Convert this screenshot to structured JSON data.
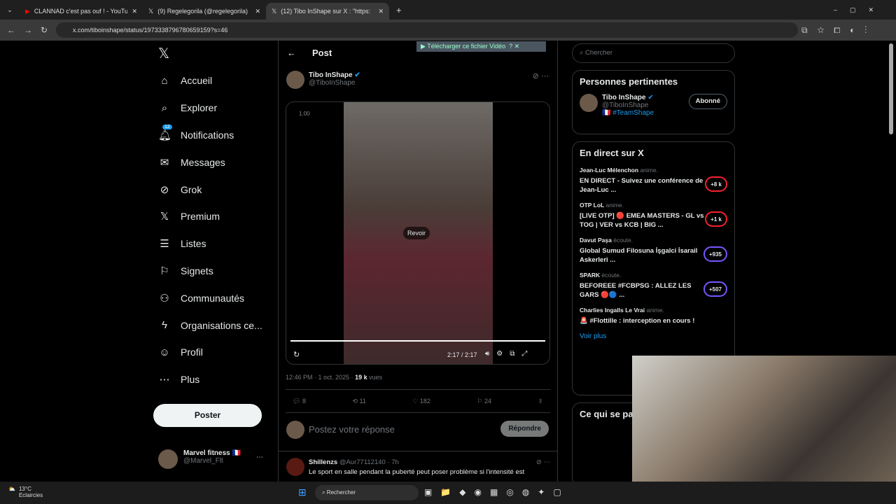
{
  "browser": {
    "tabs": [
      {
        "title": "CLANNAD c'est pas ouf ! - YouTube"
      },
      {
        "title": "(9) Regelegorila (@regelegorila)"
      },
      {
        "title": "(12) Tibo InShape sur X : \"https:"
      }
    ],
    "url": "x.com/tiboinshape/status/1973338796780659159?s=46"
  },
  "sidebar": {
    "items": [
      {
        "label": "Accueil",
        "icon": "⌂"
      },
      {
        "label": "Explorer",
        "icon": "⌕"
      },
      {
        "label": "Notifications",
        "icon": "🔔︎",
        "badge": "12"
      },
      {
        "label": "Messages",
        "icon": "✉"
      },
      {
        "label": "Grok",
        "icon": "⊘"
      },
      {
        "label": "Premium",
        "icon": "𝕏"
      },
      {
        "label": "Listes",
        "icon": "☰"
      },
      {
        "label": "Signets",
        "icon": "⚐"
      },
      {
        "label": "Communautés",
        "icon": "⚇"
      },
      {
        "label": "Organisations ce...",
        "icon": "ϟ"
      },
      {
        "label": "Profil",
        "icon": "☺"
      },
      {
        "label": "Plus",
        "icon": "⋯"
      }
    ],
    "post_button": "Poster",
    "account": {
      "name": "Marvel fitness 🇫🇷",
      "handle": "@Marvel_Flt"
    }
  },
  "post": {
    "header": "Post",
    "download_bar": "Télécharger ce fichier Vidéo",
    "author": "Tibo InShape",
    "handle": "@TiboInShape",
    "video": {
      "speed": "1.00",
      "replay": "Revoir",
      "time": "2:17 / 2:17",
      "progress": 1.0
    },
    "meta_time": "12:46 PM · 1 oct. 2025 · ",
    "views": "19 k",
    "views_label": " vues",
    "replies": "8",
    "reposts": "11",
    "likes": "182",
    "bookmarks": "24",
    "reply_placeholder": "Postez votre réponse",
    "reply_button": "Répondre"
  },
  "reply": {
    "name": "Shillenzs",
    "handle": "@Aur77112140 · 7h",
    "text": "Le sport en salle pendant la puberté peut poser problème si l'intensité est"
  },
  "right": {
    "search_placeholder": "Chercher",
    "relevant_title": "Personnes pertinentes",
    "relevant": {
      "name": "Tibo InShape",
      "handle": "@TiboInShape",
      "bio": "🇫🇷 #TeamShape",
      "button": "Abonné"
    },
    "live_title": "En direct sur X",
    "live": [
      {
        "host": "Jean-Luc Mélenchon",
        "status": "anime.",
        "title": "EN DIRECT -  Suivez une conférence de Jean-Luc ...",
        "count": "+8 k"
      },
      {
        "host": "OTP LoL",
        "status": "anime.",
        "title": "[LIVE OTP] 🔴 EMEA MASTERS - GL vs TOG | VER vs KCB | BIG ...",
        "count": "+1 k"
      },
      {
        "host": "Davut Paşa",
        "status": "écoute.",
        "title": "Global Sumud Filosuna İşgalci İsarail Askerleri ...",
        "count": "+935"
      },
      {
        "host": "SPARK",
        "status": "écoute.",
        "title": "BEFOREEE #FCBPSG : ALLEZ LES GARS 🔴🔵 ...",
        "count": "+507"
      },
      {
        "host": "Charlies Ingalls Le Vrai",
        "status": "anime.",
        "title": "🚨 #Flottille : interception en cours !",
        "count": ""
      }
    ],
    "see_more": "Voir plus",
    "trending_title": "Ce qui se pa"
  },
  "taskbar": {
    "temp": "13°C",
    "weather": "Eclaircies",
    "search": "Rechercher"
  }
}
